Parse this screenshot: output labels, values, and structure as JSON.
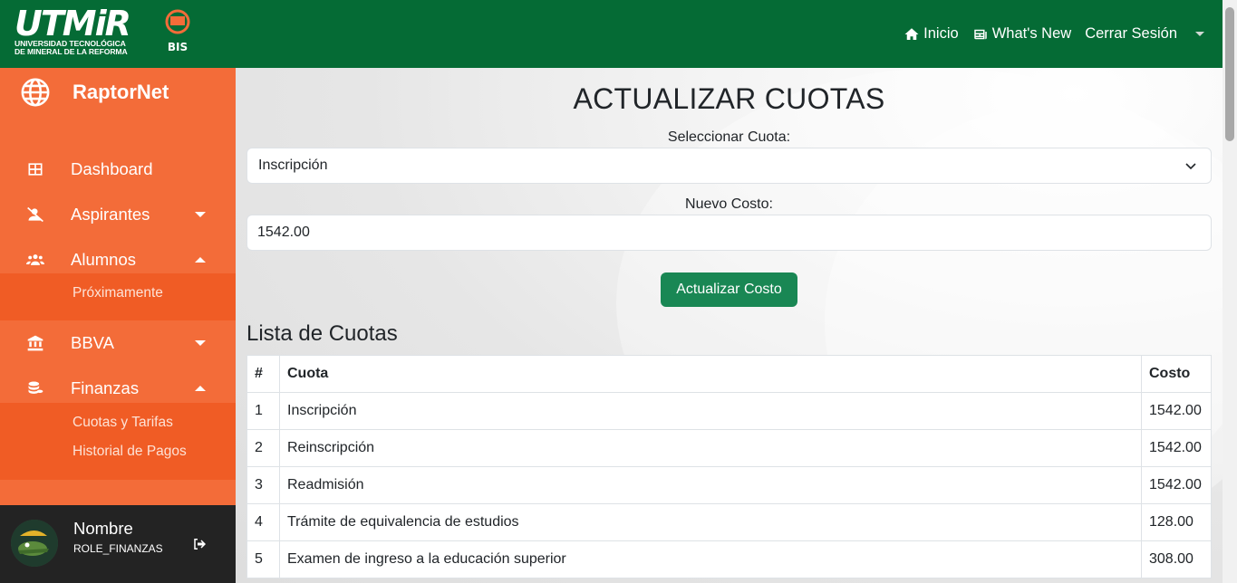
{
  "header": {
    "logo_main": "UTMiR",
    "logo_line1": "UNIVERSIDAD TECNOLÓGICA",
    "logo_line2": "DE MINERAL DE LA REFORMA",
    "logo_badge": "BIS",
    "nav": [
      {
        "label": "Inicio",
        "icon": "home-icon"
      },
      {
        "label": "What's New",
        "icon": "newspaper-icon"
      },
      {
        "label": "Cerrar Sesión",
        "icon": ""
      }
    ]
  },
  "sidebar": {
    "brand": "RaptorNet",
    "items": [
      {
        "label": "Dashboard",
        "icon": "dashboard-icon"
      },
      {
        "label": "Aspirantes",
        "icon": "user-slash-icon",
        "expanded": false
      },
      {
        "label": "Alumnos",
        "icon": "users-icon",
        "expanded": true,
        "sub": [
          "Próximamente"
        ]
      },
      {
        "label": "BBVA",
        "icon": "bank-icon",
        "expanded": false
      },
      {
        "label": "Finanzas",
        "icon": "coins-icon",
        "expanded": true,
        "sub": [
          "Cuotas y Tarifas",
          "Historial de Pagos"
        ]
      }
    ],
    "user": {
      "name": "Nombre",
      "role": "ROLE_FINANZAS"
    }
  },
  "main": {
    "title": "ACTUALIZAR CUOTAS",
    "select_label": "Seleccionar Cuota:",
    "select_value": "Inscripción",
    "cost_label": "Nuevo Costo:",
    "cost_value": "1542.00",
    "button": "Actualizar Costo",
    "list_title": "Lista de Cuotas",
    "table": {
      "headers": [
        "#",
        "Cuota",
        "Costo"
      ],
      "rows": [
        [
          "1",
          "Inscripción",
          "1542.00"
        ],
        [
          "2",
          "Reinscripción",
          "1542.00"
        ],
        [
          "3",
          "Readmisión",
          "1542.00"
        ],
        [
          "4",
          "Trámite de equivalencia de estudios",
          "128.00"
        ],
        [
          "5",
          "Examen de ingreso a la educación superior",
          "308.00"
        ]
      ]
    }
  },
  "colors": {
    "header": "#056b35",
    "sidebar": "#f36c39",
    "submenu": "#f05c25",
    "userbox": "#232323",
    "button": "#198754"
  }
}
